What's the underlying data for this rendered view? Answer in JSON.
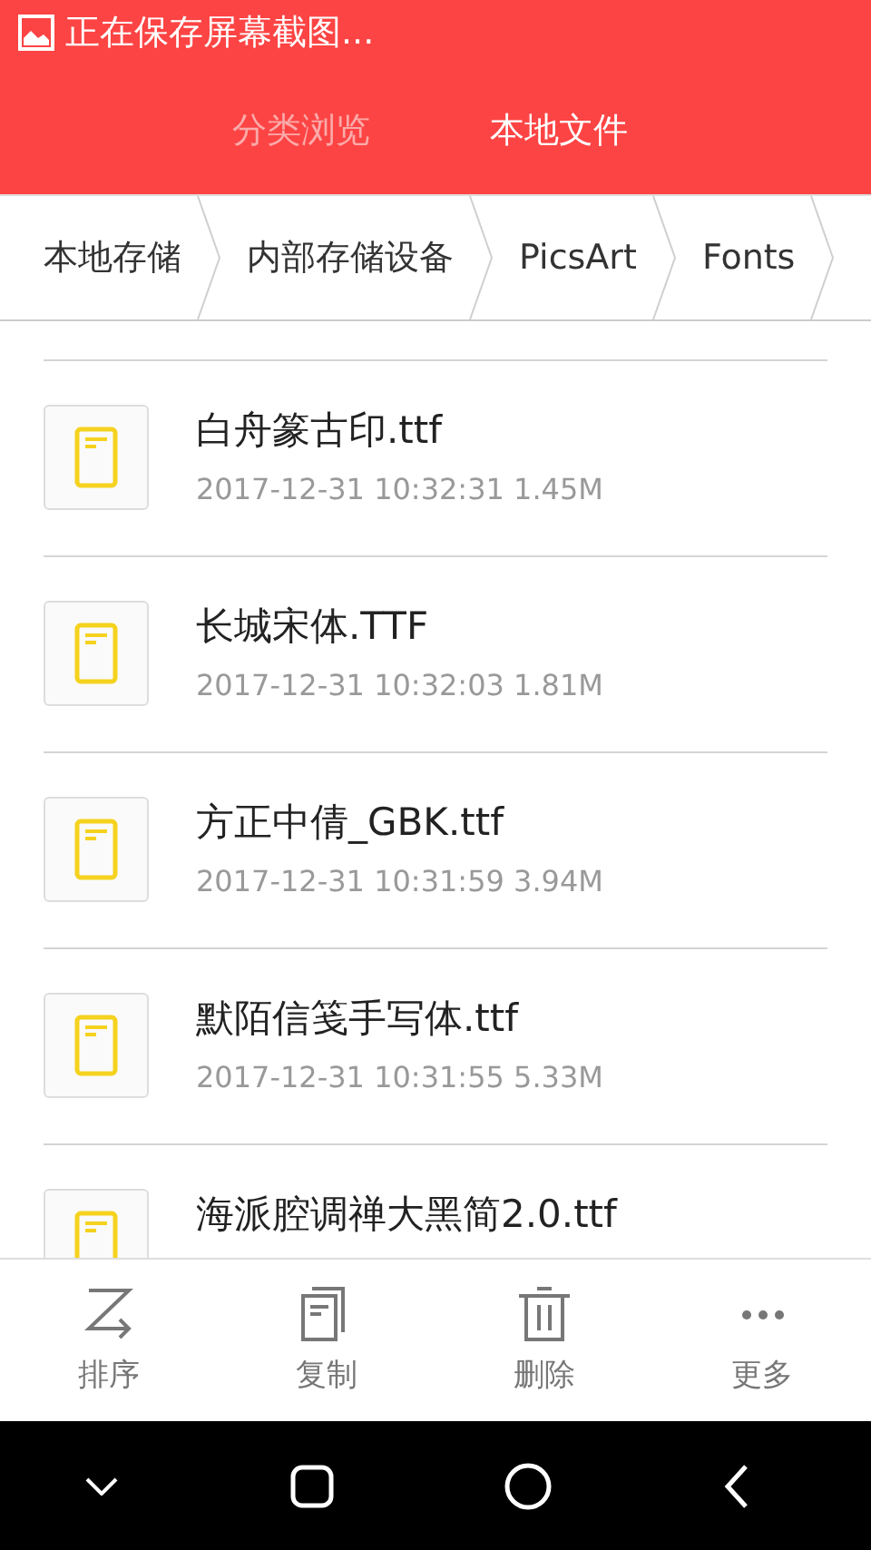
{
  "status_bar": {
    "notification": "正在保存屏幕截图..."
  },
  "tabs": [
    {
      "label": "分类浏览",
      "selected": false
    },
    {
      "label": "本地文件",
      "selected": true
    }
  ],
  "breadcrumbs": [
    "本地存储",
    "内部存储设备",
    "PicsArt",
    "Fonts"
  ],
  "files": [
    {
      "name": "白舟篆古印.ttf",
      "meta": "2017-12-31 10:32:31 1.45M"
    },
    {
      "name": "长城宋体.TTF",
      "meta": "2017-12-31 10:32:03 1.81M"
    },
    {
      "name": "方正中倩_GBK.ttf",
      "meta": "2017-12-31 10:31:59 3.94M"
    },
    {
      "name": "默陌信笺手写体.ttf",
      "meta": "2017-12-31 10:31:55 5.33M"
    },
    {
      "name": "海派腔调禅大黑简2.0.ttf"
    }
  ],
  "toolbar": [
    {
      "kind": "sort",
      "label": "排序"
    },
    {
      "kind": "copy",
      "label": "复制"
    },
    {
      "kind": "delete",
      "label": "删除"
    },
    {
      "kind": "more",
      "label": "更多"
    }
  ]
}
